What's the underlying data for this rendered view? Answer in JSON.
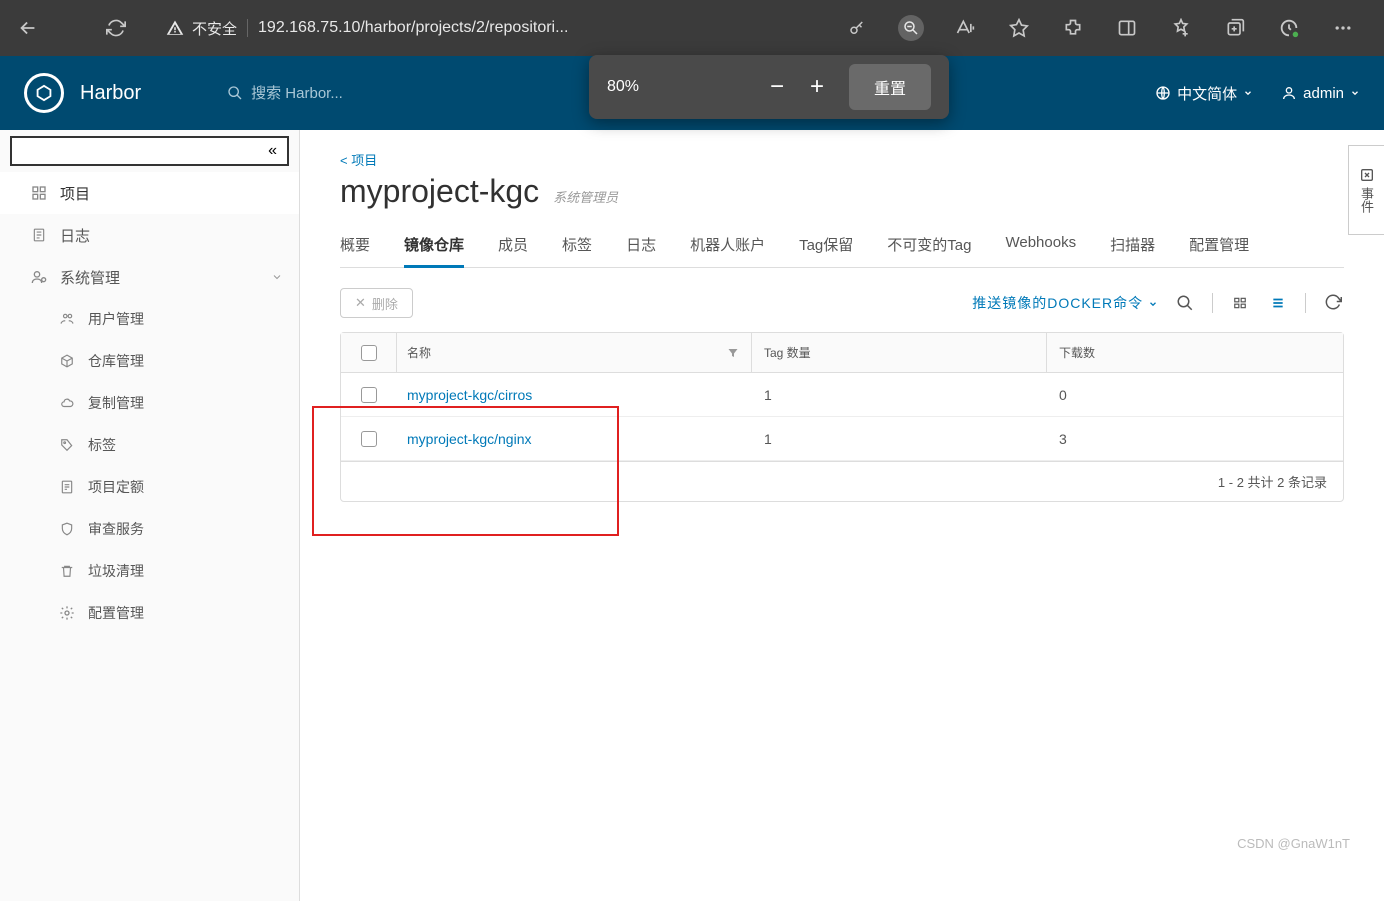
{
  "browser": {
    "warn_text": "不安全",
    "url": "192.168.75.10/harbor/projects/2/repositori...",
    "zoom_pct": "80%",
    "zoom_reset": "重置"
  },
  "harbor": {
    "title": "Harbor",
    "search_placeholder": "搜索 Harbor...",
    "lang_label": "中文简体",
    "user_label": "admin"
  },
  "sidebar": {
    "items": {
      "projects": "项目",
      "logs": "日志",
      "sysadmin": "系统管理",
      "user_mgmt": "用户管理",
      "repo_mgmt": "仓库管理",
      "repl_mgmt": "复制管理",
      "labels": "标签",
      "quota": "项目定额",
      "audit": "审查服务",
      "gc": "垃圾清理",
      "config": "配置管理"
    }
  },
  "main": {
    "breadcrumb": "< 项目",
    "project_name": "myproject-kgc",
    "role": "系统管理员",
    "tabs": {
      "summary": "概要",
      "repos": "镜像仓库",
      "members": "成员",
      "labels": "标签",
      "logs": "日志",
      "robots": "机器人账户",
      "tag_retain": "Tag保留",
      "immutable": "不可变的Tag",
      "webhooks": "Webhooks",
      "scanners": "扫描器",
      "config": "配置管理"
    },
    "delete_btn": "删除",
    "push_cmd": "推送镜像的DOCKER命令",
    "table": {
      "col_name": "名称",
      "col_tags": "Tag 数量",
      "col_downloads": "下载数",
      "rows": [
        {
          "name": "myproject-kgc/cirros",
          "tags": "1",
          "downloads": "0"
        },
        {
          "name": "myproject-kgc/nginx",
          "tags": "1",
          "downloads": "3"
        }
      ],
      "footer": "1 - 2 共计 2 条记录"
    }
  },
  "event_tab": "事件",
  "watermark": "CSDN @GnaW1nT"
}
